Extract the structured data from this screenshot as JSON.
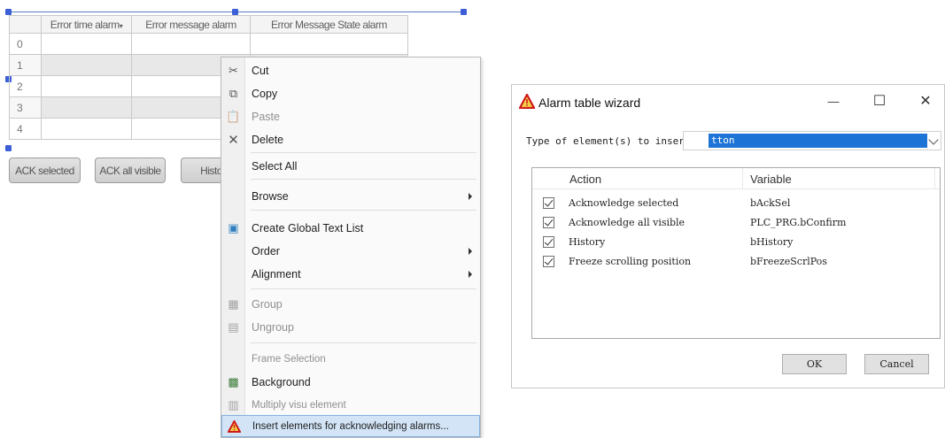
{
  "alarm_table": {
    "columns": [
      "",
      "Error time alarm",
      "Error message alarm",
      "Error Message State alarm"
    ],
    "rows": [
      "0",
      "1",
      "2",
      "3",
      "4"
    ]
  },
  "buttons": {
    "ack_selected": "ACK selected",
    "ack_all_visible": "ACK all visible",
    "history": "Histo"
  },
  "context_menu": {
    "items": [
      {
        "label": "Cut",
        "icon": "scissors-icon",
        "enabled": true
      },
      {
        "label": "Copy",
        "icon": "copy-icon",
        "enabled": true
      },
      {
        "label": "Paste",
        "icon": "paste-icon",
        "enabled": false
      },
      {
        "label": "Delete",
        "icon": "delete-icon",
        "enabled": true
      },
      {
        "label": "Select All",
        "enabled": true
      },
      {
        "label": "Browse",
        "submenu": true,
        "enabled": true
      },
      {
        "label": "Create Global Text List",
        "icon": "text-list-icon",
        "enabled": true
      },
      {
        "label": "Order",
        "submenu": true,
        "enabled": true
      },
      {
        "label": "Alignment",
        "submenu": true,
        "enabled": true
      },
      {
        "label": "Group",
        "icon": "group-icon",
        "enabled": false
      },
      {
        "label": "Ungroup",
        "icon": "ungroup-icon",
        "enabled": false
      },
      {
        "label": "Frame Selection",
        "enabled": false
      },
      {
        "label": "Background",
        "icon": "background-icon",
        "enabled": true
      },
      {
        "label": "Multiply visu element",
        "icon": "multiply-icon",
        "enabled": false
      },
      {
        "label": "Insert elements for acknowledging alarms...",
        "icon": "warning-icon",
        "enabled": true,
        "highlighted": true
      }
    ]
  },
  "dialog": {
    "title": "Alarm table wizard",
    "type_label": "Type of element(s) to insert:",
    "type_prefix": "insert:",
    "type_value": "tton",
    "columns": {
      "action": "Action",
      "variable": "Variable"
    },
    "rows": [
      {
        "action": "Acknowledge selected",
        "variable": "bAckSel",
        "checked": true
      },
      {
        "action": "Acknowledge all visible",
        "variable": "PLC_PRG.bConfirm",
        "checked": true
      },
      {
        "action": "History",
        "variable": "bHistory",
        "checked": true
      },
      {
        "action": "Freeze scrolling position",
        "variable": "bFreezeScrlPos",
        "checked": true
      }
    ],
    "ok": "OK",
    "cancel": "Cancel",
    "minimize": "—",
    "maximize": "☐",
    "close": "✕"
  },
  "colors": {
    "selection_handle": "#3c5fd8",
    "menu_highlight": "#d3e4f7",
    "combo_selection": "#1e74d6"
  }
}
